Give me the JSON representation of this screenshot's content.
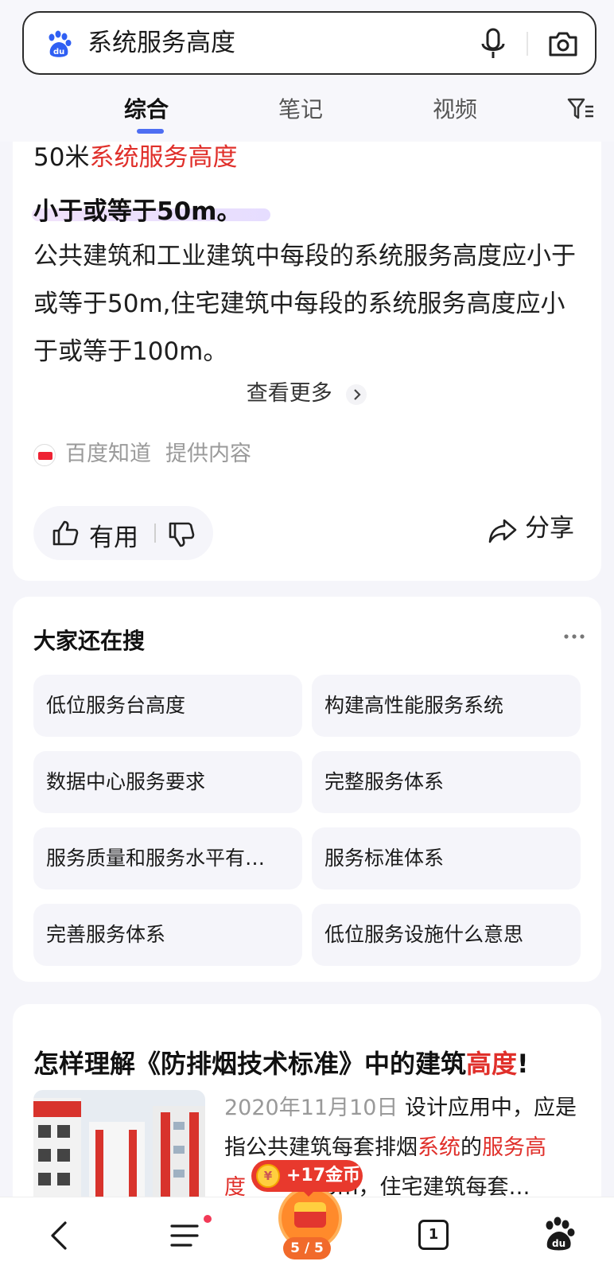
{
  "search": {
    "query": "系统服务高度",
    "icons": [
      "baidu-paw-icon",
      "microphone-icon",
      "camera-icon"
    ]
  },
  "tabs": [
    {
      "label": "综合",
      "active": true
    },
    {
      "label": "笔记",
      "active": false
    },
    {
      "label": "视频",
      "active": false
    }
  ],
  "answer": {
    "heading_prefix": "50米",
    "heading_highlight": "系统服务高度",
    "bold_line": "小于或等于50m。",
    "body": "公共建筑和工业建筑中每段的系统服务高度应小于或等于50m,住宅建筑中每段的系统服务高度应小于或等于100m。",
    "view_more": "查看更多",
    "source_name": "百度知道",
    "source_suffix": "提供内容",
    "useful_label": "有用",
    "share_label": "分享"
  },
  "related": {
    "title": "大家还在搜",
    "items": [
      "低位服务台高度",
      "构建高性能服务系统",
      "数据中心服务要求",
      "完整服务体系",
      "服务质量和服务水平有…",
      "服务标准体系",
      "完善服务体系",
      "低位服务设施什么意思"
    ]
  },
  "article": {
    "title_prefix": "怎样理解《防排烟技术标准》中的建筑",
    "title_highlight": "高度",
    "title_suffix": "!",
    "date": "2020年11月10日",
    "snippet_1": " 设计应用中，应是指公共建筑每套排烟",
    "snippet_hl1": "系统",
    "snippet_2": "的",
    "snippet_hl2": "服务高",
    "snippet_3": "度",
    "snippet_4": "0m，住宅建筑每套…"
  },
  "reward": {
    "coin_text": "+17金币",
    "coin_glyph": "¥",
    "progress": "5 / 5"
  },
  "bottom_nav": {
    "tab_count": "1",
    "has_notification_dot": true
  },
  "colors": {
    "highlight_red": "#e0302b",
    "accent_blue": "#4e6ef2",
    "reward_red": "#e8392d",
    "reward_orange": "#ff8a2b"
  }
}
